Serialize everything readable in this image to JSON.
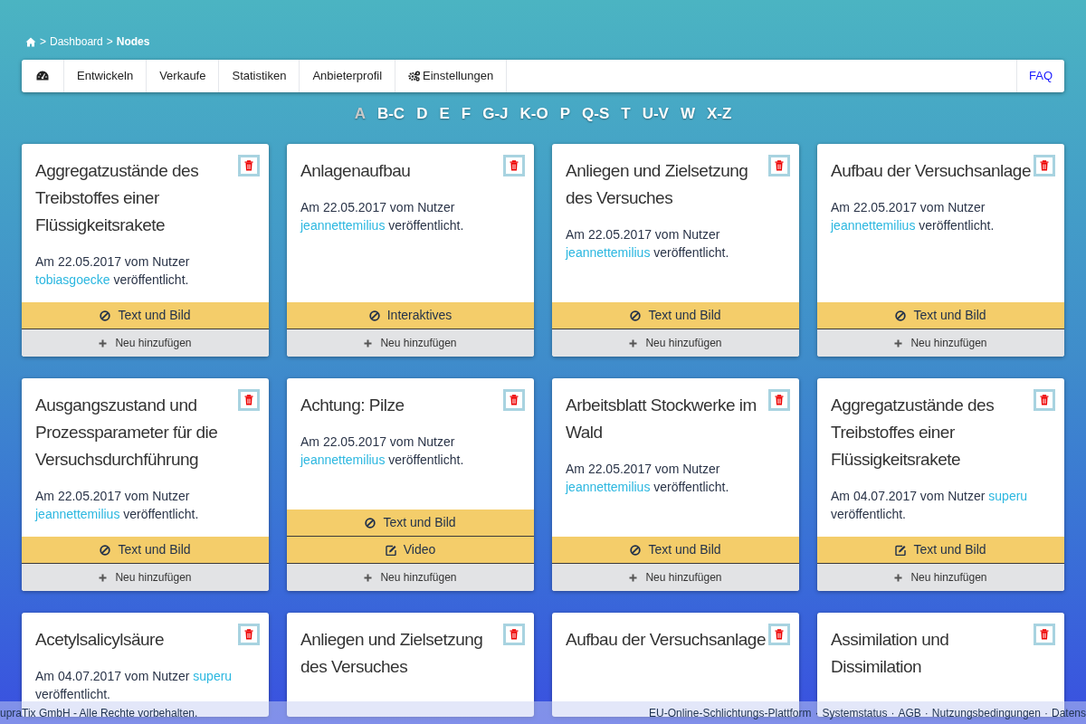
{
  "breadcrumb": {
    "separator": ">",
    "items": [
      "Dashboard"
    ],
    "current": "Nodes"
  },
  "nav": {
    "items": [
      {
        "kind": "icon"
      },
      {
        "kind": "text",
        "label": "Entwickeln"
      },
      {
        "kind": "text",
        "label": "Verkaufe"
      },
      {
        "kind": "text",
        "label": "Statistiken"
      },
      {
        "kind": "text",
        "label": "Anbieterprofil"
      },
      {
        "kind": "settings",
        "label": "Einstellungen"
      }
    ],
    "right": "FAQ"
  },
  "letters": [
    {
      "label": "A",
      "selected": true
    },
    {
      "label": "B-C",
      "selected": false
    },
    {
      "label": "D",
      "selected": false
    },
    {
      "label": "E",
      "selected": false
    },
    {
      "label": "F",
      "selected": false
    },
    {
      "label": "G-J",
      "selected": false
    },
    {
      "label": "K-O",
      "selected": false
    },
    {
      "label": "P",
      "selected": false
    },
    {
      "label": "Q-S",
      "selected": false
    },
    {
      "label": "T",
      "selected": false
    },
    {
      "label": "U-V",
      "selected": false
    },
    {
      "label": "W",
      "selected": false
    },
    {
      "label": "X-Z",
      "selected": false
    }
  ],
  "cards": [
    {
      "title": "Aggregatzustände des Treibstoffes einer Flüssigkeitsrakete",
      "meta": {
        "prefix": "Am 22.05.2017 vom Nutzer",
        "user": "tobiasgoecke",
        "suffix": "veröffentlicht."
      },
      "types": [
        {
          "kind": "ban",
          "label": "Text und Bild"
        }
      ],
      "add": "Neu hinzufügen"
    },
    {
      "title": "Anlagenaufbau",
      "meta": {
        "prefix": "Am 22.05.2017 vom Nutzer",
        "user": "jeannettemilius",
        "suffix": "veröffentlicht."
      },
      "types": [
        {
          "kind": "ban",
          "label": "Interaktives"
        }
      ],
      "add": "Neu hinzufügen"
    },
    {
      "title": "Anliegen und Zielsetzung des Versuches",
      "meta": {
        "prefix": "Am 22.05.2017 vom Nutzer",
        "user": "jeannettemilius",
        "suffix": "veröffentlicht."
      },
      "types": [
        {
          "kind": "ban",
          "label": "Text und Bild"
        }
      ],
      "add": "Neu hinzufügen"
    },
    {
      "title": "Aufbau der Versuchsanlage",
      "meta": {
        "prefix": "Am 22.05.2017 vom Nutzer",
        "user": "jeannettemilius",
        "suffix": "veröffentlicht."
      },
      "types": [
        {
          "kind": "ban",
          "label": "Text und Bild"
        }
      ],
      "add": "Neu hinzufügen"
    },
    {
      "title": "Ausgangszustand und Prozessparameter für die Versuchsdurchführung",
      "meta": {
        "prefix": "Am 22.05.2017 vom Nutzer",
        "user": "jeannettemilius",
        "suffix": "veröffentlicht."
      },
      "types": [
        {
          "kind": "ban",
          "label": "Text und Bild"
        }
      ],
      "add": "Neu hinzufügen"
    },
    {
      "title": "Achtung: Pilze",
      "meta": {
        "prefix": "Am 22.05.2017 vom Nutzer",
        "user": "jeannettemilius",
        "suffix": "veröffentlicht."
      },
      "types": [
        {
          "kind": "ban",
          "label": "Text und Bild"
        },
        {
          "kind": "edit",
          "label": "Video"
        }
      ],
      "add": "Neu hinzufügen"
    },
    {
      "title": "Arbeitsblatt Stockwerke im Wald",
      "meta": {
        "prefix": "Am 22.05.2017 vom Nutzer",
        "user": "jeannettemilius",
        "suffix": "veröffentlicht."
      },
      "types": [
        {
          "kind": "ban",
          "label": "Text und Bild"
        }
      ],
      "add": "Neu hinzufügen"
    },
    {
      "title": "Aggregatzustände des Treibstoffes einer Flüssigkeitsrakete",
      "meta": {
        "prefix": "Am 04.07.2017 vom Nutzer",
        "user": "superu",
        "suffix": "veröffentlicht."
      },
      "types": [
        {
          "kind": "edit",
          "label": "Text und Bild"
        }
      ],
      "add": "Neu hinzufügen"
    },
    {
      "title": "Acetylsalicylsäure",
      "meta": {
        "prefix": "Am 04.07.2017 vom Nutzer",
        "user": "superu",
        "suffix": "veröffentlicht."
      }
    },
    {
      "title": "Anliegen und Zielsetzung des Versuches"
    },
    {
      "title": "Aufbau der Versuchsanlage"
    },
    {
      "title": "Assimilation und Dissimilation"
    }
  ],
  "footer": {
    "left": "upraTix GmbH - Alle Rechte vorbehalten.",
    "separator": "·",
    "links": [
      "EU-Online-Schlichtungs-Plattform",
      "Systemstatus",
      "AGB",
      "Nutzungsbedingungen",
      "Datens"
    ]
  }
}
